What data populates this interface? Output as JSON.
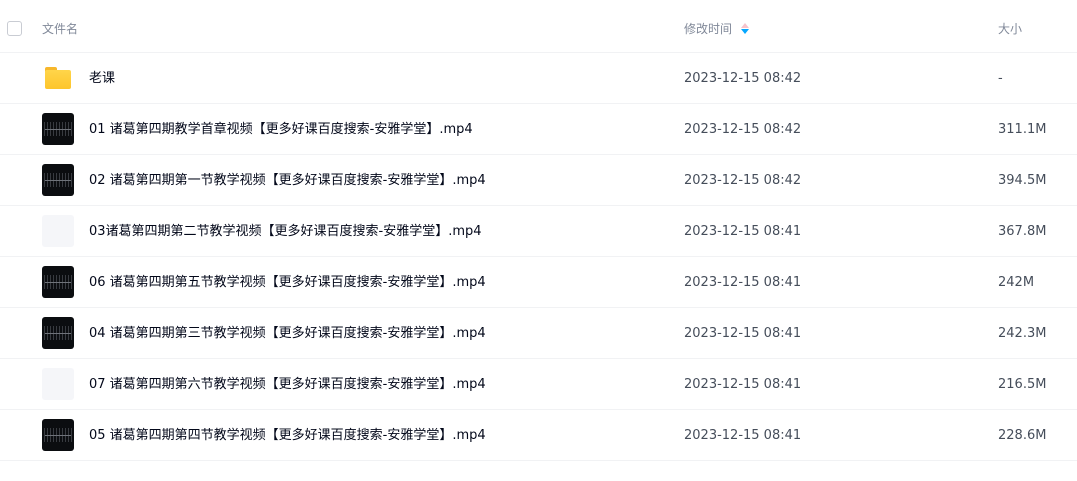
{
  "header": {
    "name_label": "文件名",
    "time_label": "修改时间",
    "size_label": "大小"
  },
  "files": [
    {
      "type": "folder",
      "name": "老课",
      "time": "2023-12-15 08:42",
      "size": "-"
    },
    {
      "type": "video",
      "name": "01 诸葛第四期教学首章视频【更多好课百度搜索-安雅学堂】.mp4",
      "time": "2023-12-15 08:42",
      "size": "311.1M"
    },
    {
      "type": "video",
      "name": "02 诸葛第四期第一节教学视频【更多好课百度搜索-安雅学堂】.mp4",
      "time": "2023-12-15 08:42",
      "size": "394.5M"
    },
    {
      "type": "blank",
      "name": "03诸葛第四期第二节教学视频【更多好课百度搜索-安雅学堂】.mp4",
      "time": "2023-12-15 08:41",
      "size": "367.8M"
    },
    {
      "type": "video",
      "name": "06 诸葛第四期第五节教学视频【更多好课百度搜索-安雅学堂】.mp4",
      "time": "2023-12-15 08:41",
      "size": "242M"
    },
    {
      "type": "video",
      "name": "04 诸葛第四期第三节教学视频【更多好课百度搜索-安雅学堂】.mp4",
      "time": "2023-12-15 08:41",
      "size": "242.3M"
    },
    {
      "type": "blank",
      "name": "07 诸葛第四期第六节教学视频【更多好课百度搜索-安雅学堂】.mp4",
      "time": "2023-12-15 08:41",
      "size": "216.5M"
    },
    {
      "type": "video",
      "name": "05 诸葛第四期第四节教学视频【更多好课百度搜索-安雅学堂】.mp4",
      "time": "2023-12-15 08:41",
      "size": "228.6M"
    }
  ]
}
